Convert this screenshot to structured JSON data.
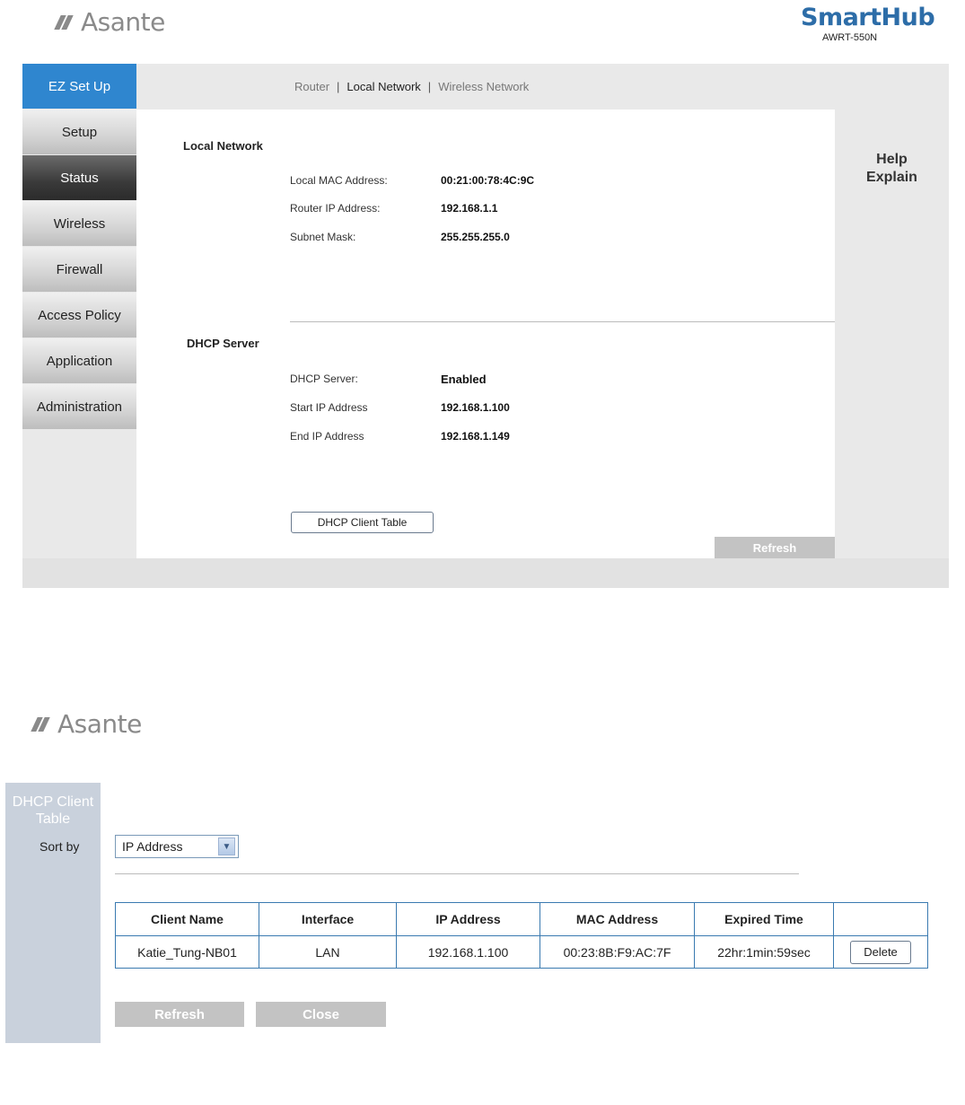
{
  "header": {
    "brand": "Asante",
    "product": "SmartHub",
    "model": "AWRT-550N"
  },
  "sidebar": {
    "items": [
      {
        "label": "EZ Set Up"
      },
      {
        "label": "Setup"
      },
      {
        "label": "Status"
      },
      {
        "label": "Wireless"
      },
      {
        "label": "Firewall"
      },
      {
        "label": "Access Policy"
      },
      {
        "label": "Application"
      },
      {
        "label": "Administration"
      }
    ]
  },
  "breadcrumb": {
    "items": [
      "Router",
      "Local Network",
      "Wireless Network"
    ],
    "separator": "|"
  },
  "local_network": {
    "title": "Local Network",
    "mac_label": "Local MAC Address:",
    "mac_value": "00:21:00:78:4C:9C",
    "ip_label": "Router IP Address:",
    "ip_value": "192.168.1.1",
    "mask_label": "Subnet Mask:",
    "mask_value": "255.255.255.0"
  },
  "dhcp_server": {
    "title": "DHCP Server",
    "server_label": "DHCP Server:",
    "server_value": "Enabled",
    "start_label": "Start IP Address",
    "start_value": "192.168.1.100",
    "end_label": "End IP Address",
    "end_value": "192.168.1.149",
    "client_table_button": "DHCP Client Table"
  },
  "help": {
    "line1": "Help",
    "line2": "Explain"
  },
  "refresh_label": "Refresh",
  "client_window": {
    "brand": "Asante",
    "title_line1": "DHCP Client",
    "title_line2": "Table",
    "sort_label": "Sort by",
    "sort_value": "IP Address",
    "columns": [
      "Client Name",
      "Interface",
      "IP Address",
      "MAC Address",
      "Expired Time",
      ""
    ],
    "rows": [
      {
        "client_name": "Katie_Tung-NB01",
        "interface": "LAN",
        "ip": "192.168.1.100",
        "mac": "00:23:8B:F9:AC:7F",
        "expired": "22hr:1min:59sec",
        "action": "Delete"
      }
    ],
    "refresh_label": "Refresh",
    "close_label": "Close"
  },
  "colors": {
    "active_nav": "#2f86cf",
    "brand_blue": "#2d6da8",
    "panel_gray": "#e9e9e9",
    "table_border": "#3a7ab0"
  }
}
